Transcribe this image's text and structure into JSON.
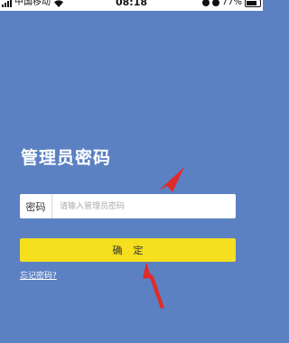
{
  "status_bar": {
    "carrier": "中国移动",
    "time": "08:18",
    "battery": "77%",
    "battery_level": 0.77
  },
  "login": {
    "title": "管理员密码",
    "password_label": "密码",
    "password_placeholder": "请输入管理员密码",
    "password_value": "",
    "confirm_label": "确定",
    "forgot_link": "忘记密码?"
  },
  "colors": {
    "background": "#5b81c3",
    "button": "#f5df1e",
    "annotation_arrow": "#e02b2b"
  }
}
